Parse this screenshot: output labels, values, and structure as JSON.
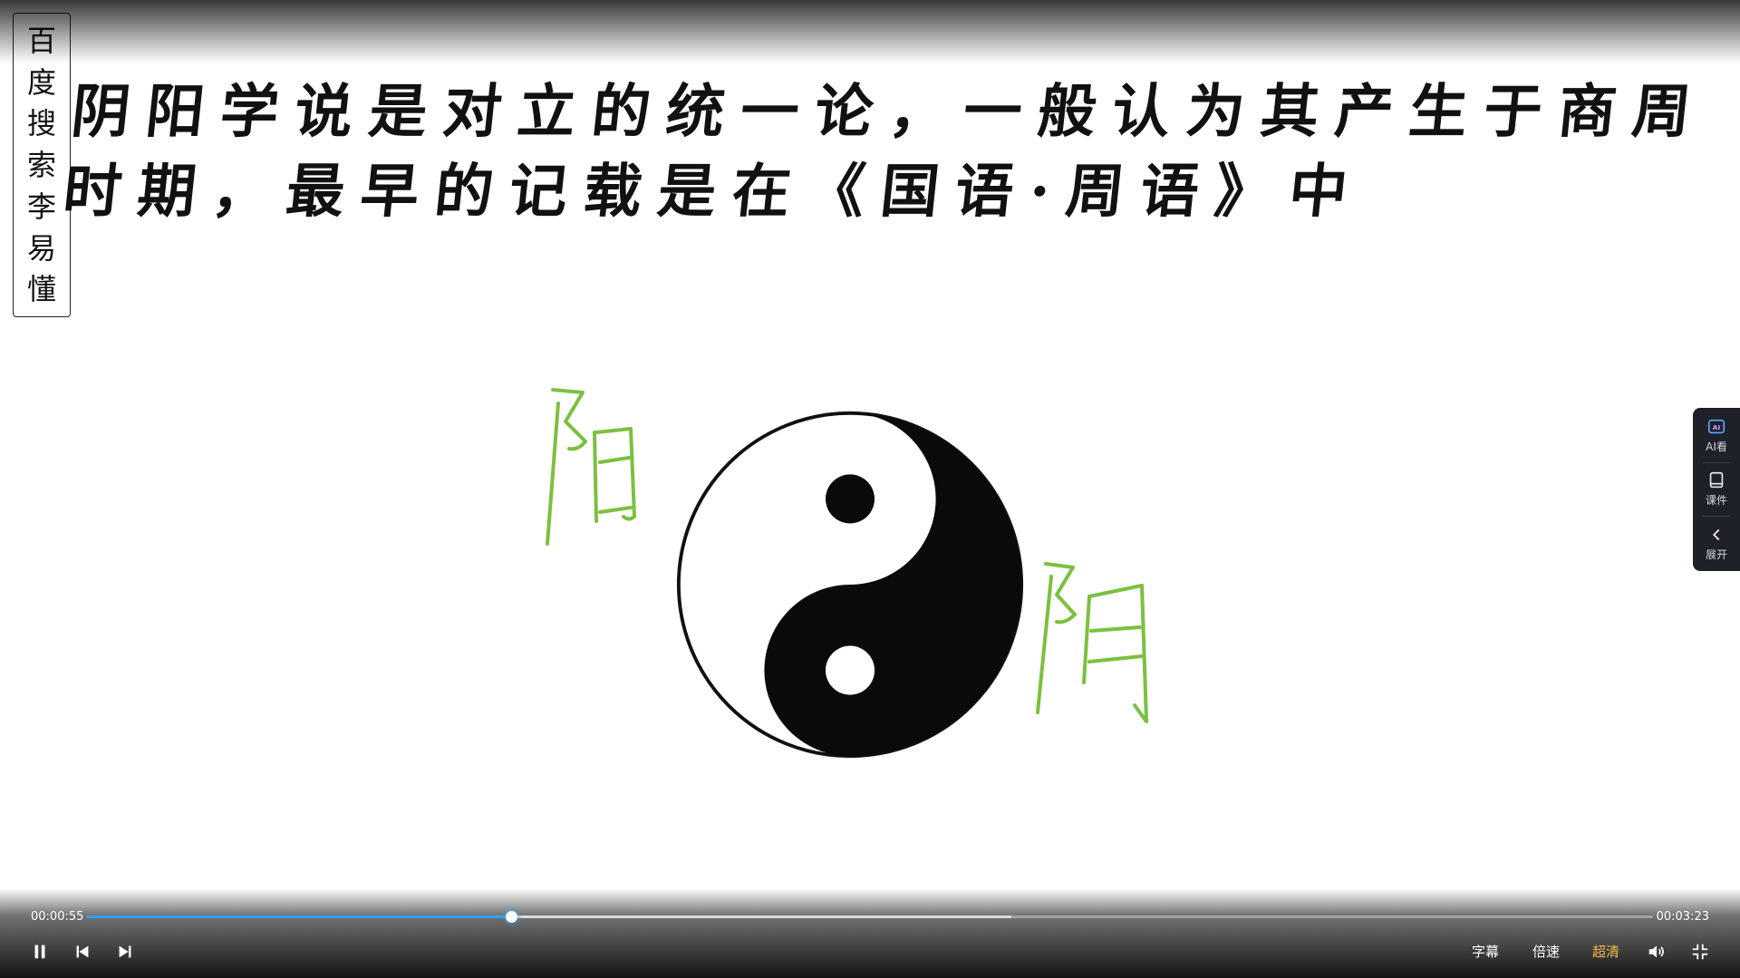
{
  "watermark": {
    "chars": [
      "百",
      "度",
      "搜",
      "索",
      "李",
      "易",
      "懂"
    ]
  },
  "slide": {
    "heading_lines": [
      "阴阳学说是对立的统一论，一般认为其产生于商周",
      "时期，最早的记载是在《国语·周语》中"
    ],
    "label_yang": "阳",
    "label_yin": "阴",
    "label_color": "#7cc040"
  },
  "side_panel": {
    "items": [
      {
        "label": "AI看",
        "icon": "ai-watch-icon"
      },
      {
        "label": "课件",
        "icon": "book-icon"
      },
      {
        "label": "展开",
        "icon": "chevron-left-icon"
      }
    ]
  },
  "player": {
    "current_time": "00:00:55",
    "total_time": "00:03:23",
    "played_fraction": 0.271,
    "buffered_fraction": 0.59,
    "subtitle_label": "字幕",
    "speed_label": "倍速",
    "quality_label": "超清",
    "accent_color": "#2fa3ff",
    "quality_color": "#f5b74a"
  }
}
